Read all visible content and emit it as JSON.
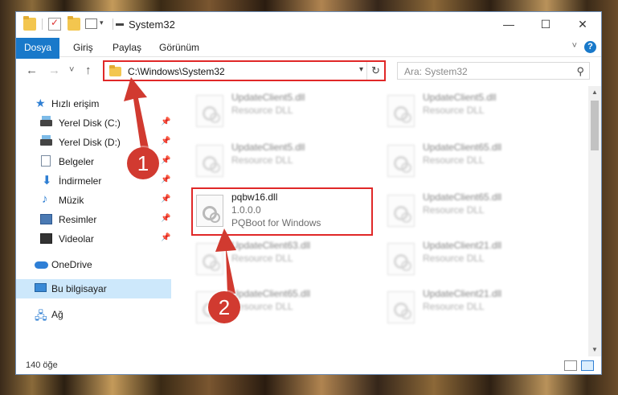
{
  "window": {
    "title": "System32",
    "controls": {
      "minimize": "—",
      "maximize": "☐",
      "close": "✕"
    }
  },
  "ribbon": {
    "tabs": [
      "Dosya",
      "Giriş",
      "Paylaş",
      "Görünüm"
    ],
    "help": "?"
  },
  "nav": {
    "back": "←",
    "forward": "→",
    "recent": "˅",
    "up": "↑",
    "address": "C:\\Windows\\System32",
    "refresh": "↻",
    "search_placeholder": "Ara: System32",
    "search_icon": "search-icon"
  },
  "sidebar": {
    "items": [
      {
        "label": "Hızlı erişim",
        "icon": "star-icon",
        "pinned": false
      },
      {
        "label": "Yerel Disk (C:)",
        "icon": "drive-icon",
        "pinned": true
      },
      {
        "label": "Yerel Disk (D:)",
        "icon": "drive-icon",
        "pinned": true
      },
      {
        "label": "Belgeler",
        "icon": "documents-icon",
        "pinned": true
      },
      {
        "label": "İndirmeler",
        "icon": "downloads-icon",
        "pinned": true
      },
      {
        "label": "Müzik",
        "icon": "music-icon",
        "pinned": true
      },
      {
        "label": "Resimler",
        "icon": "pictures-icon",
        "pinned": true
      },
      {
        "label": "Videolar",
        "icon": "videos-icon",
        "pinned": true
      },
      {
        "label": "OneDrive",
        "icon": "onedrive-icon",
        "pinned": false
      },
      {
        "label": "Bu bilgisayar",
        "icon": "computer-icon",
        "pinned": false,
        "selected": true
      },
      {
        "label": "Ağ",
        "icon": "network-icon",
        "pinned": false
      }
    ]
  },
  "files": [
    {
      "name": "UpdateClient5.dll",
      "line2": "Resource DLL",
      "line3": "",
      "blurred": true
    },
    {
      "name": "UpdateClient5.dll",
      "line2": "Resource DLL",
      "line3": "",
      "blurred": true
    },
    {
      "name": "UpdateClient5.dll",
      "line2": "Resource DLL",
      "line3": "",
      "blurred": true
    },
    {
      "name": "UpdateClient65.dll",
      "line2": "Resource DLL",
      "line3": "",
      "blurred": true
    },
    {
      "name": "pqbw16.dll",
      "line2": "1.0.0.0",
      "line3": "PQBoot for Windows",
      "blurred": false,
      "highlighted": true
    },
    {
      "name": "UpdateClient65.dll",
      "line2": "Resource DLL",
      "line3": "",
      "blurred": true
    },
    {
      "name": "UpdateClient63.dll",
      "line2": "Resource DLL",
      "line3": "",
      "blurred": true
    },
    {
      "name": "UpdateClient21.dll",
      "line2": "Resource DLL",
      "line3": "",
      "blurred": true
    },
    {
      "name": "UpdateClient65.dll",
      "line2": "Resource DLL",
      "line3": "",
      "blurred": true
    },
    {
      "name": "UpdateClient21.dll",
      "line2": "Resource DLL",
      "line3": "",
      "blurred": true
    }
  ],
  "status": {
    "count": "140 öğe"
  },
  "annotations": {
    "badge1": "1",
    "badge2": "2",
    "color": "#d13a30"
  }
}
